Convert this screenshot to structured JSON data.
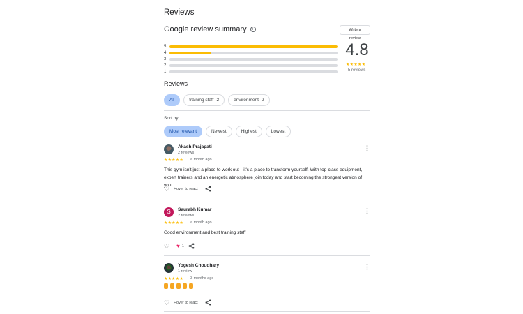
{
  "header": {
    "title": "Reviews"
  },
  "summary": {
    "title": "Google review summary",
    "info_icon": "info-icon",
    "write_review_label": "Write a review",
    "bars": [
      {
        "label": "5",
        "fraction": 1.0
      },
      {
        "label": "4",
        "fraction": 0.25
      },
      {
        "label": "3",
        "fraction": 0
      },
      {
        "label": "2",
        "fraction": 0
      },
      {
        "label": "1",
        "fraction": 0
      }
    ],
    "rating": "4.8",
    "stars": "★★★★★",
    "count": "5 reviews",
    "star_color": "#fbbc04"
  },
  "reviews_section": {
    "title": "Reviews",
    "topic_chips": [
      {
        "label": "All",
        "count": "",
        "active": true
      },
      {
        "label": "training staff",
        "count": "2",
        "active": false
      },
      {
        "label": "environment",
        "count": "2",
        "active": false
      }
    ],
    "sort_label": "Sort by",
    "sort_chips": [
      {
        "label": "Most relevant",
        "active": true
      },
      {
        "label": "Newest",
        "active": false
      },
      {
        "label": "Highest",
        "active": false
      },
      {
        "label": "Lowest",
        "active": false
      }
    ]
  },
  "reviews": [
    {
      "name": "Akash Prajapati",
      "sub": "2 reviews",
      "stars": "★★★★★",
      "time": "a month ago",
      "text": "This gym isn't just a place to work out—it's a place to transform yourself. With top-class equipment, expert trainers and an energetic atmosphere join today and start becoming the strongest version of you!",
      "react_label": "Hover to react"
    },
    {
      "name": "Saurabh Kumar",
      "initial": "S",
      "sub": "2 reviews",
      "stars": "★★★★★",
      "time": "a month ago",
      "text": "Good environment and best training staff",
      "like_count": "1"
    },
    {
      "name": "Yogesh Choudhary",
      "sub": "1 review",
      "stars": "★★★★★",
      "time": "3 months ago",
      "react_label": "Hover to react"
    }
  ],
  "colors": {
    "accent_chip": "#aecbfa",
    "heart": "#e91e63"
  }
}
